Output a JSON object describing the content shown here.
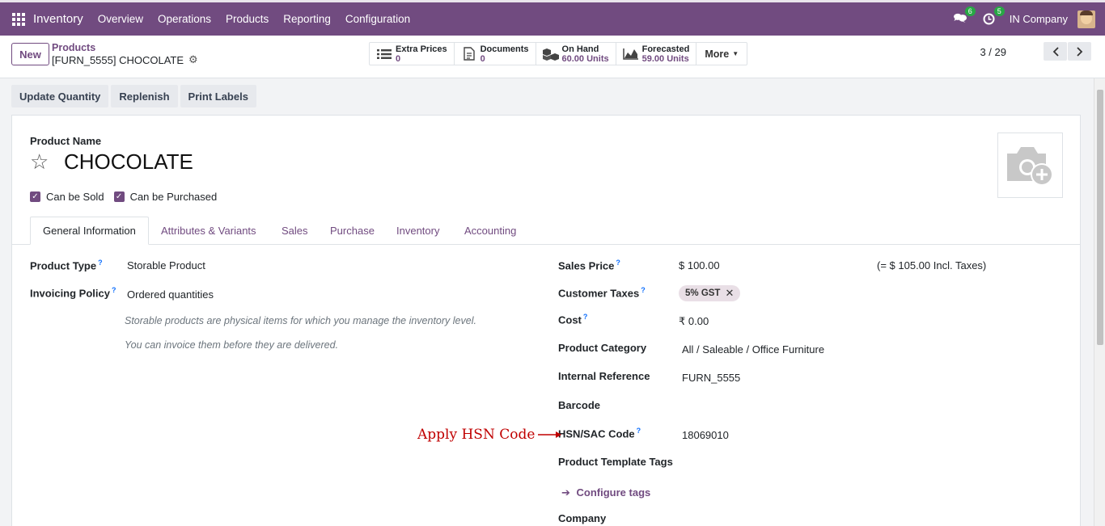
{
  "navbar": {
    "app_name": "Inventory",
    "menu": [
      "Overview",
      "Operations",
      "Products",
      "Reporting",
      "Configuration"
    ],
    "messages_badge": "6",
    "activities_badge": "5",
    "company": "IN Company"
  },
  "control": {
    "new_label": "New",
    "breadcrumb_parent": "Products",
    "breadcrumb_current": "[FURN_5555] CHOCOLATE",
    "stats": [
      {
        "label": "Extra Prices",
        "value": "0",
        "icon": "list-icon"
      },
      {
        "label": "Documents",
        "value": "0",
        "icon": "document-icon"
      },
      {
        "label": "On Hand",
        "value": "60.00 Units",
        "icon": "cubes-icon"
      },
      {
        "label": "Forecasted",
        "value": "59.00 Units",
        "icon": "area-chart-icon"
      }
    ],
    "more_label": "More",
    "pager": "3 / 29"
  },
  "actions": [
    "Update Quantity",
    "Replenish",
    "Print Labels"
  ],
  "form": {
    "name_label": "Product Name",
    "name": "CHOCOLATE",
    "can_be_sold": "Can be Sold",
    "can_be_purchased": "Can be Purchased",
    "tabs": [
      "General Information",
      "Attributes & Variants",
      "Sales",
      "Purchase",
      "Inventory",
      "Accounting"
    ],
    "left": {
      "product_type_label": "Product Type",
      "product_type": "Storable Product",
      "invoicing_policy_label": "Invoicing Policy",
      "invoicing_policy": "Ordered quantities",
      "help1": "Storable products are physical items for which you manage the inventory level.",
      "help2": "You can invoice them before they are delivered."
    },
    "right": {
      "sales_price_label": "Sales Price",
      "sales_price": "$ 100.00",
      "sales_price_incl": "(= $ 105.00 Incl. Taxes)",
      "customer_taxes_label": "Customer Taxes",
      "customer_tax_tag": "5% GST",
      "cost_label": "Cost",
      "cost": "₹ 0.00",
      "category_label": "Product Category",
      "category": "All / Saleable / Office Furniture",
      "internal_ref_label": "Internal Reference",
      "internal_ref": "FURN_5555",
      "barcode_label": "Barcode",
      "hsn_label": "HSN/SAC Code",
      "hsn": "18069010",
      "template_tags_label": "Product Template Tags",
      "configure_tags": "Configure tags",
      "company_label": "Company"
    }
  },
  "annotation": "Apply HSN Code",
  "colors": {
    "brand": "#714b80",
    "annotation": "#c00000"
  }
}
